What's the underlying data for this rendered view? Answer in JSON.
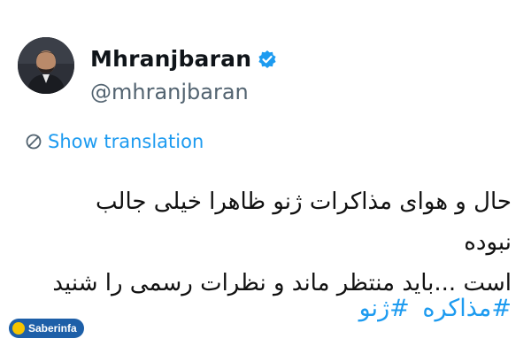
{
  "tweet": {
    "author_name": "Mhranjbaran",
    "handle": "@mhranjbaran",
    "show_translation": "Show translation",
    "text_line1": "حال و هوای مذاکرات ژنو  ظاهرا خیلی جالب نبوده",
    "text_line2": "است ...باید منتظر ماند و نظرات رسمی را شنید",
    "hashtags": [
      "#مذاکره",
      "#ژنو"
    ]
  },
  "watermark": {
    "label": "Saberinfa"
  },
  "colors": {
    "accent": "#1d9bf0",
    "handle": "#536471",
    "text": "#0f1419",
    "watermark_bg": "#1d5fa8"
  },
  "icons": {
    "verified": "verified-badge-icon",
    "translate": "globe-icon"
  }
}
